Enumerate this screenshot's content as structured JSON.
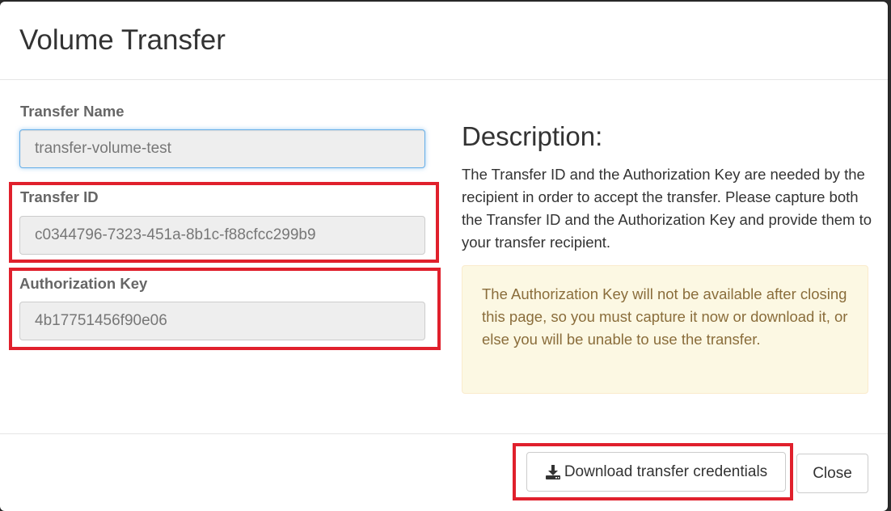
{
  "modal": {
    "title": "Volume Transfer"
  },
  "form": {
    "transfer_name": {
      "label": "Transfer Name",
      "value": "transfer-volume-test"
    },
    "transfer_id": {
      "label": "Transfer ID",
      "value": "c0344796-7323-451a-8b1c-f88cfcc299b9"
    },
    "authorization_key": {
      "label": "Authorization Key",
      "value": "4b17751456f90e06"
    }
  },
  "description": {
    "title": "Description:",
    "text": "The Transfer ID and the Authorization Key are needed by the recipient in order to accept the transfer. Please capture both the Transfer ID and the Authorization Key and provide them to your transfer recipient.",
    "warning": "The Authorization Key will not be available after closing this page, so you must capture it now or download it, or else you will be unable to use the transfer."
  },
  "footer": {
    "download_label": "Download transfer credentials",
    "close_label": "Close"
  },
  "colors": {
    "highlight": "#e0202c",
    "warning_bg": "#fcf8e3",
    "warning_text": "#8a6d3b",
    "focus_border": "#66afe9"
  },
  "icons": {
    "download": "download-icon"
  }
}
